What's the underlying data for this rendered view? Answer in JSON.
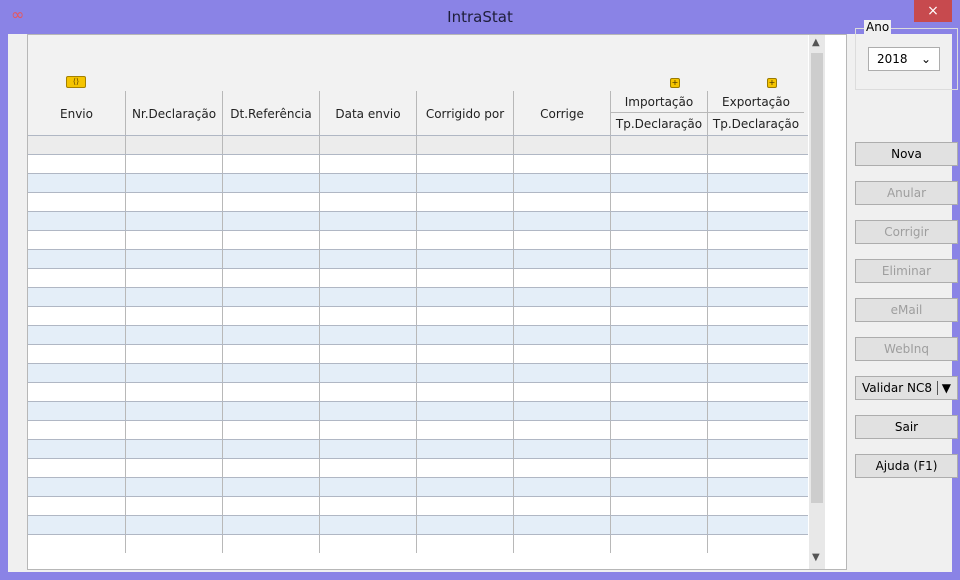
{
  "window": {
    "title": "IntraStat",
    "app_icon": "link-icon",
    "close_glyph": "×"
  },
  "grid": {
    "nav_toggle_glyph": "⟨⟩",
    "columns": [
      {
        "label": "Envio"
      },
      {
        "label": "Nr.Declaração"
      },
      {
        "label": "Dt.Referência"
      },
      {
        "label": "Data envio"
      },
      {
        "label": "Corrigido por"
      },
      {
        "label": "Corrige"
      }
    ],
    "group_columns": [
      {
        "label": "Importação",
        "sub_label": "Tp.Declaração"
      },
      {
        "label": "Exportação",
        "sub_label": "Tp.Declaração"
      }
    ],
    "expand_glyph": "+"
  },
  "year_panel": {
    "label": "Ano",
    "selected_year": "2018"
  },
  "buttons": {
    "nova": "Nova",
    "anular": "Anular",
    "corrigir": "Corrigir",
    "eliminar": "Eliminar",
    "email": "eMail",
    "webinq": "WebInq",
    "validar_nc8": "Validar NC8",
    "sair": "Sair",
    "ajuda": "Ajuda (F1)"
  }
}
